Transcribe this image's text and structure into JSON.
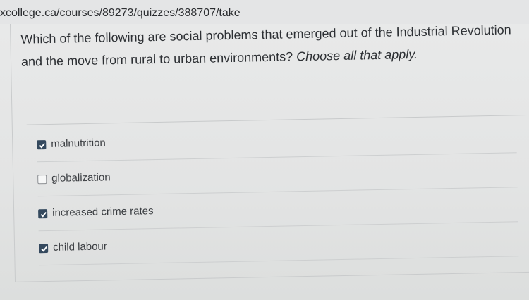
{
  "browser": {
    "url": "xcollege.ca/courses/89273/quizzes/388707/take"
  },
  "question": {
    "text": "Which of the following are social problems that emerged out of the Industrial Revolution and the move from rural to urban environments?",
    "hint": "Choose all that apply."
  },
  "options": [
    {
      "label": "malnutrition",
      "checked": true
    },
    {
      "label": "globalization",
      "checked": false
    },
    {
      "label": "increased crime rates",
      "checked": true
    },
    {
      "label": "child labour",
      "checked": true
    }
  ],
  "colors": {
    "checkbox_checked": "#34495e",
    "background": "#e7e8e8"
  }
}
